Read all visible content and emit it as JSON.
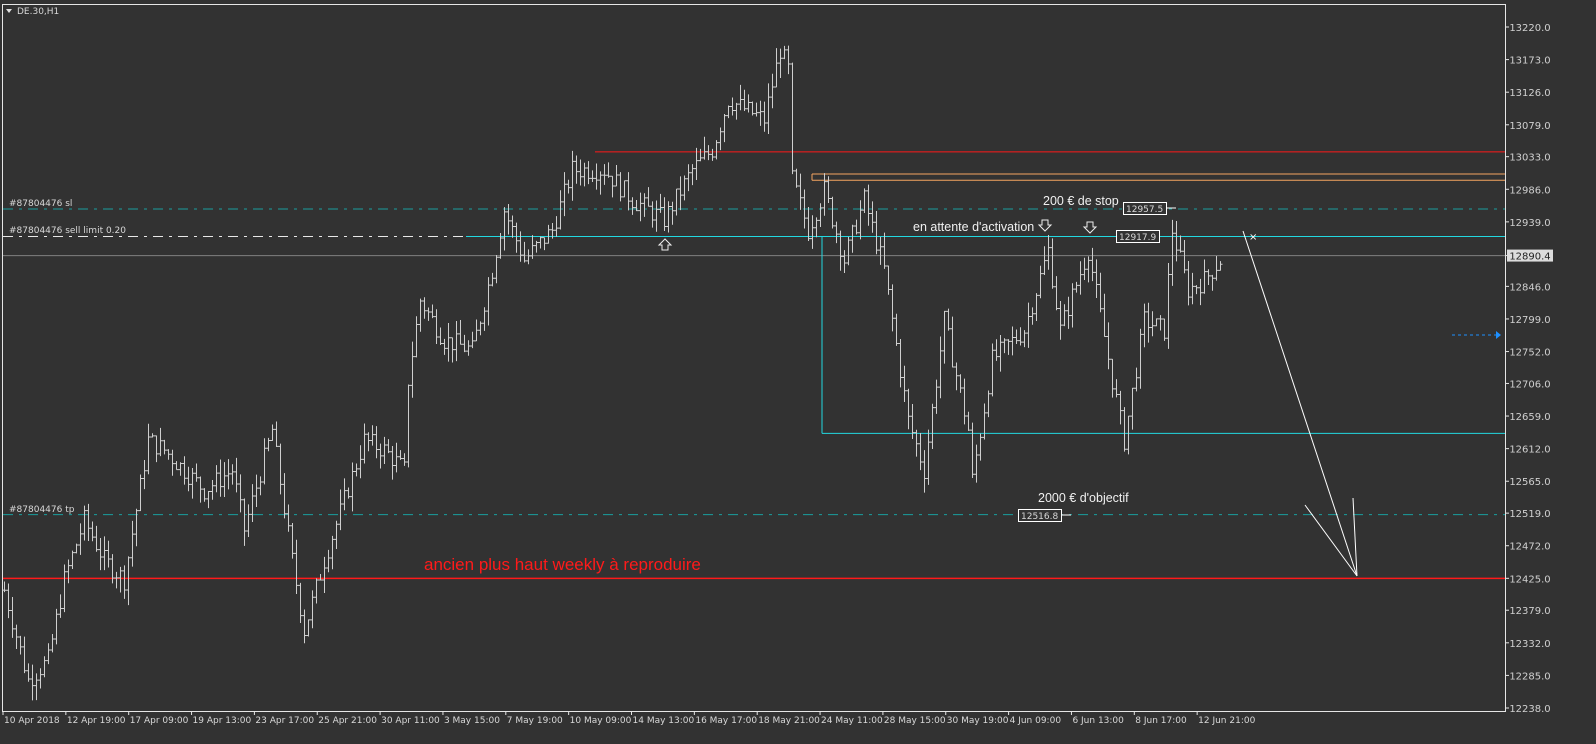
{
  "window": {
    "title": "DE.30,H1"
  },
  "colors": {
    "background": "#323232",
    "bars": "#cfcfcf",
    "red": "#ff1a1a",
    "orange": "#f4a460",
    "teal": "#1a9e9e",
    "cyan": "#22d8e0",
    "bid": "#808080",
    "blue": "#1e90ff"
  },
  "chart_data": {
    "type": "ohlc",
    "symbol": "DE.30",
    "timeframe": "H1",
    "ylim": [
      12238.0,
      13220.0
    ],
    "y_ticks": [
      "13220.0",
      "13173.0",
      "13126.0",
      "13079.0",
      "13033.0",
      "12986.0",
      "12939.0",
      "12890.4",
      "12846.0",
      "12799.0",
      "12752.0",
      "12706.0",
      "12659.0",
      "12612.0",
      "12565.0",
      "12519.0",
      "12472.0",
      "12425.0",
      "12379.0",
      "12332.0",
      "12285.0",
      "12238.0"
    ],
    "current_price": "12890.4",
    "x_ticks": [
      "10 Apr 2018",
      "12 Apr 19:00",
      "17 Apr 09:00",
      "19 Apr 13:00",
      "23 Apr 17:00",
      "25 Apr 21:00",
      "30 Apr 11:00",
      "3 May 15:00",
      "7 May 19:00",
      "10 May 09:00",
      "14 May 13:00",
      "16 May 17:00",
      "18 May 21:00",
      "24 May 11:00",
      "28 May 15:00",
      "30 May 19:00",
      "4 Jun 09:00",
      "6 Jun 13:00",
      "8 Jun 17:00",
      "12 Jun 21:00"
    ],
    "price_path": [
      [
        0,
        12408
      ],
      [
        6,
        12278
      ],
      [
        11,
        12307
      ],
      [
        15,
        12423
      ],
      [
        20,
        12509
      ],
      [
        25,
        12451
      ],
      [
        30,
        12423
      ],
      [
        36,
        12624
      ],
      [
        40,
        12610
      ],
      [
        50,
        12552
      ],
      [
        57,
        12581
      ],
      [
        60,
        12495
      ],
      [
        67,
        12639
      ],
      [
        72,
        12451
      ],
      [
        75,
        12350
      ],
      [
        80,
        12451
      ],
      [
        85,
        12538
      ],
      [
        90,
        12624
      ],
      [
        95,
        12610
      ],
      [
        100,
        12581
      ],
      [
        101,
        12711
      ],
      [
        104,
        12826
      ],
      [
        110,
        12769
      ],
      [
        117,
        12754
      ],
      [
        122,
        12870
      ],
      [
        125,
        12956
      ],
      [
        130,
        12884
      ],
      [
        137,
        12927
      ],
      [
        142,
        13014
      ],
      [
        150,
        13014
      ],
      [
        157,
        12971
      ],
      [
        165,
        12942
      ],
      [
        172,
        13014
      ],
      [
        177,
        13043
      ],
      [
        181,
        13115
      ],
      [
        190,
        13086
      ],
      [
        194,
        13187
      ],
      [
        196,
        13158
      ],
      [
        197,
        13000
      ],
      [
        201,
        12927
      ],
      [
        205,
        12985
      ],
      [
        210,
        12884
      ],
      [
        215,
        12971
      ],
      [
        220,
        12870
      ],
      [
        226,
        12653
      ],
      [
        230,
        12581
      ],
      [
        235,
        12797
      ],
      [
        241,
        12639
      ],
      [
        242,
        12567
      ],
      [
        247,
        12740
      ],
      [
        255,
        12783
      ],
      [
        261,
        12898
      ],
      [
        264,
        12783
      ],
      [
        271,
        12898
      ],
      [
        277,
        12711
      ],
      [
        280,
        12624
      ],
      [
        285,
        12797
      ],
      [
        290,
        12783
      ],
      [
        292,
        12927
      ],
      [
        296,
        12841
      ],
      [
        300,
        12855
      ],
      [
        304,
        12884
      ]
    ],
    "levels": {
      "old_high_red": 13040,
      "orange_upper": 13008,
      "orange_lower": 12999,
      "stop_loss": 12957.5,
      "sell_limit": 12917.9,
      "range_low": 12634,
      "take_profit": 12516.8,
      "weekly_high": 12425
    },
    "labels": {
      "sl": "#87804476 sl",
      "sell_limit": "#87804476 sell limit 0.20",
      "tp": "#87804476 tp",
      "sl_box": "12957.5",
      "sell_limit_box": "12917.9",
      "tp_box": "12516.8"
    },
    "annotations": {
      "stop": "200 € de stop",
      "waiting": "en attente d'activation",
      "target": "2000 € d'objectif",
      "weekly": "ancien plus haut weekly à reproduire"
    }
  }
}
